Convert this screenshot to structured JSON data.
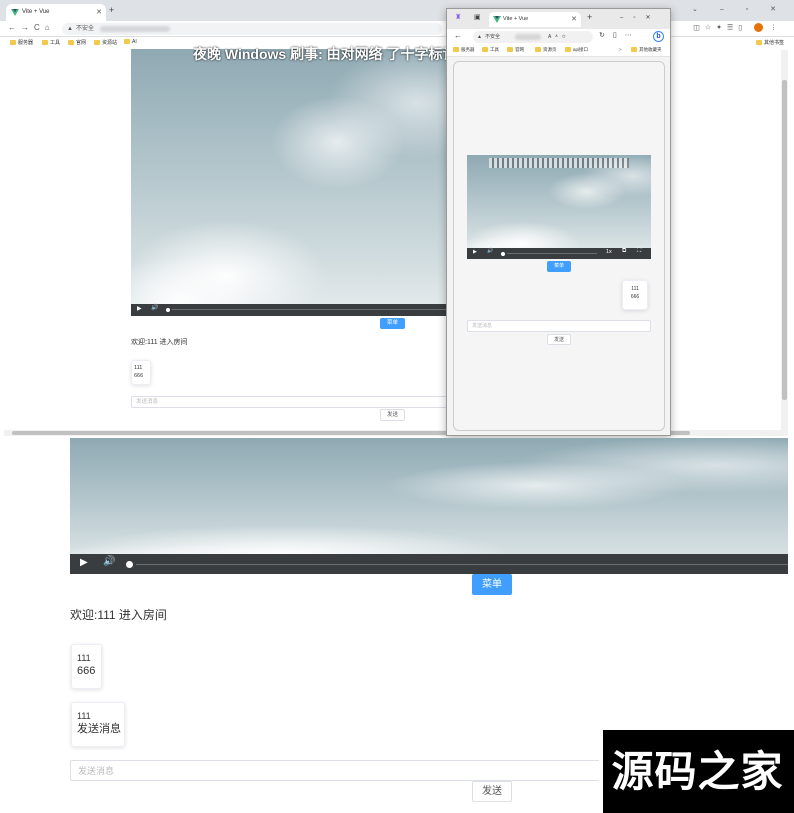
{
  "main_browser": {
    "tab_title": "Vite + Vue",
    "tab_new": "+",
    "window_controls": "⌄ – ▫ ✕",
    "address_prefix": "不安全",
    "bookmarks": [
      "服务器",
      "工具",
      "官网",
      "资源站",
      "AI"
    ],
    "bookmarks_other": "其他书签"
  },
  "mobile_browser": {
    "tab_title": "Vite + Vue",
    "address_prefix": "不安全",
    "bookmarks": [
      "服务器",
      "工具",
      "官网",
      "资源页",
      "api接口"
    ],
    "bookmarks_other": "其他收藏夹",
    "bing": "b",
    "video_speed": "1x",
    "menu_label": "菜单",
    "message": {
      "user": "111",
      "text": "666"
    },
    "input_placeholder": "发送消息",
    "send_label": "发送"
  },
  "desktop_page": {
    "subtitle_text": "夜晚 Windows 刷事: 由对网络 了十字标记",
    "menu_label": "菜单",
    "welcome": "欢迎:111 进入房间",
    "messages": [
      {
        "user": "111",
        "text": "666"
      }
    ],
    "input_placeholder": "发送消息",
    "send_label": "发送"
  },
  "zoomed_page": {
    "menu_label": "菜单",
    "welcome": "欢迎:111 进入房间",
    "messages": [
      {
        "user": "111",
        "text": "666"
      },
      {
        "user": "111",
        "text": "发送消息"
      }
    ],
    "input_placeholder": "发送消息",
    "send_label": "发送"
  },
  "watermark": "源码之家",
  "icons": {
    "play": "▶",
    "volume": "🔊",
    "pip": "⧉",
    "fullscreen": "⛶",
    "close": "✕"
  },
  "colors": {
    "accent": "#409eff",
    "video_bar": "#3a3d40",
    "vue_green": "#41b883"
  }
}
